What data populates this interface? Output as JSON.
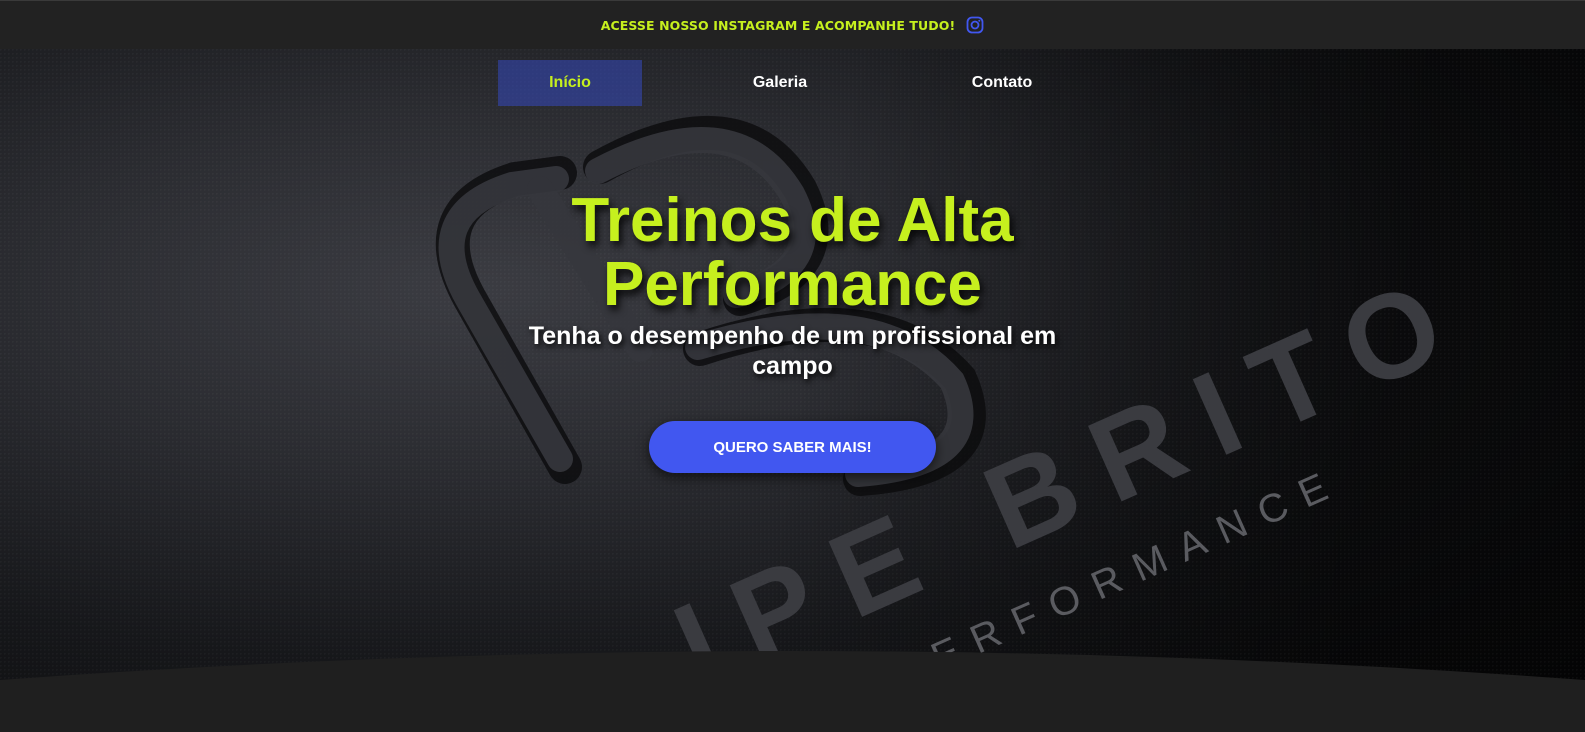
{
  "topbar": {
    "text": "ACESSE NOSSO INSTAGRAM E ACOMPANHE TUDO!",
    "icon": "instagram-icon",
    "accent_color": "#c6f01e",
    "icon_color": "#4157f0"
  },
  "nav": {
    "items": [
      {
        "label": "Início",
        "active": true
      },
      {
        "label": "Galeria",
        "active": false
      },
      {
        "label": "Contato",
        "active": false
      }
    ]
  },
  "hero": {
    "title_line1": "Treinos de Alta",
    "title_line2": "Performance",
    "subtitle_line1": "Tenha o desempenho de um profissional em",
    "subtitle_line2": "campo",
    "cta_label": "QUERO SABER MAIS!",
    "cta_color": "#4157f0",
    "background_brand_text": "IPE BRITO",
    "background_brand_tagline": "PERFORMANCE"
  }
}
